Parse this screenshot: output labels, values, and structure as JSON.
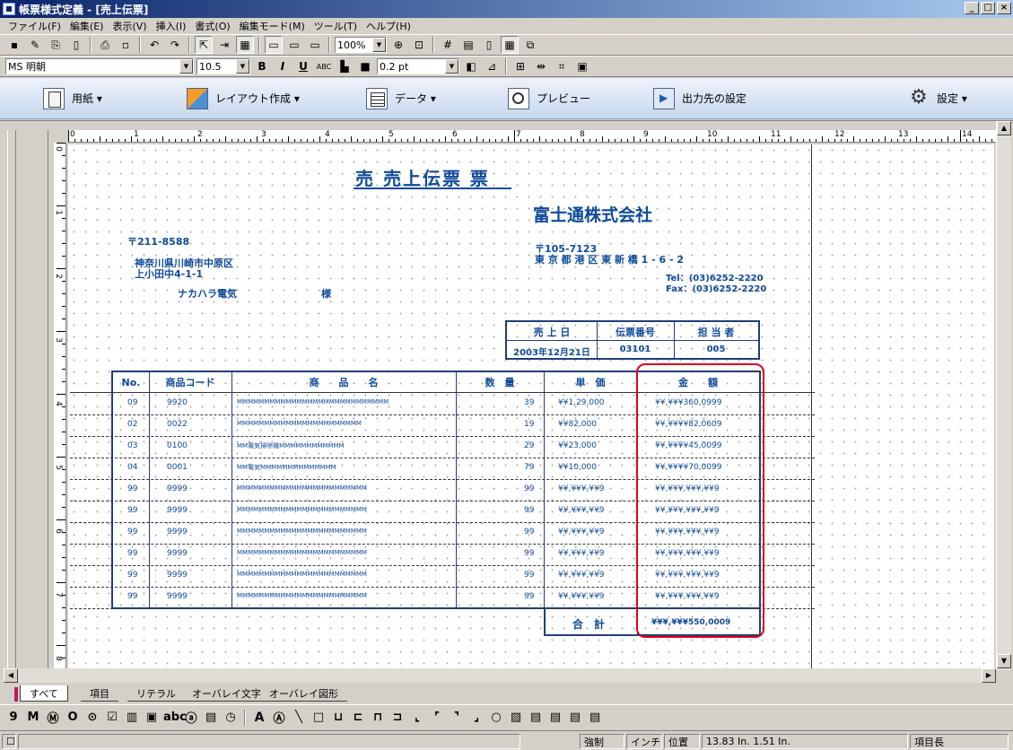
{
  "window": {
    "title": "帳票様式定義 - [売上伝票]",
    "min": "_",
    "max": "□",
    "close": "×"
  },
  "menu": [
    "ファイル(F)",
    "編集(E)",
    "表示(V)",
    "挿入(I)",
    "書式(O)",
    "編集モード(M)",
    "ツール(T)",
    "ヘルプ(H)"
  ],
  "toolbar": {
    "zoom": "100%",
    "font": "MS 明朝",
    "size": "10.5",
    "bold": "B",
    "italic": "I",
    "underline": "U",
    "abc": "ABC",
    "line_width": "0.2 pt"
  },
  "commands": [
    {
      "label": "用紙 ▾",
      "icon": "paper-icon"
    },
    {
      "label": "レイアウト作成 ▾",
      "icon": "layout-icon"
    },
    {
      "label": "データ ▾",
      "icon": "data-icon"
    },
    {
      "label": "プレビュー",
      "icon": "preview-icon"
    },
    {
      "label": "出力先の設定",
      "icon": "output-icon"
    },
    {
      "label": "設定 ▾",
      "icon": "settings-icon"
    }
  ],
  "ruler_top": [
    "0",
    "1",
    "2",
    "3",
    "4",
    "5",
    "6",
    "7",
    "8",
    "9",
    "10",
    "11",
    "12",
    "13",
    "14"
  ],
  "ruler_left": [
    "0",
    "1",
    "2",
    "3",
    "4",
    "5",
    "6",
    "7",
    "8"
  ],
  "form": {
    "title": "売 売上伝票 票",
    "company": "富士通株式会社",
    "postal": "〒211-8588",
    "address1": "神奈川県川崎市中原区",
    "address2": "上小田中4-1-1",
    "customer": "ナカハラ電気",
    "honorific": "様",
    "co_postal": "〒105-7123",
    "co_address": "東 京 都 港 区 東 新 橋 1 - 6 - 2",
    "tel": "Tel：(03)6252-2220",
    "fax": "Fax：(03)6252-2220",
    "header_labels": [
      "売 上 日",
      "伝票番号",
      "担 当 者"
    ],
    "header_values": [
      "2003年12月21日",
      "03101",
      "005"
    ],
    "columns": [
      "No.",
      "商品コード",
      "商　　品　　名",
      "数　量",
      "単　価",
      "金　　額"
    ],
    "rows": [
      {
        "no": "09",
        "code": "9920",
        "name": "MMMMMMMMMMMMMMMMMMMMMMMMMMMM",
        "qty": "39",
        "price": "¥¥1,29,000",
        "amount": "¥¥,¥¥¥360,0999"
      },
      {
        "no": "02",
        "code": "0022",
        "name": "MMMMMMMMMMMMMMMMMMMMMMM",
        "qty": "19",
        "price": "¥¥82,000",
        "amount": "¥¥,¥¥¥¥82,0609"
      },
      {
        "no": "03",
        "code": "0100",
        "name": "MM電気掃除機MMMMMMMMMMMM",
        "qty": "29",
        "price": "¥¥23,000",
        "amount": "¥¥,¥¥¥¥45,0099"
      },
      {
        "no": "04",
        "code": "0001",
        "name": "MM電気MMMMMMMMMMMMMM",
        "qty": "79",
        "price": "¥¥10,000",
        "amount": "¥¥,¥¥¥¥70,0099"
      },
      {
        "no": "99",
        "code": "9999",
        "name": "MMMMMMMMMMMMMMMMMMMMMMMM",
        "qty": "99",
        "price": "¥¥,¥¥¥,¥¥9",
        "amount": "¥¥,¥¥¥,¥¥¥,¥¥9"
      },
      {
        "no": "99",
        "code": "9999",
        "name": "MMMMMMMMMMMMMMMMMMMMMMMM",
        "qty": "99",
        "price": "¥¥,¥¥¥,¥¥9",
        "amount": "¥¥,¥¥¥,¥¥¥,¥¥9"
      },
      {
        "no": "99",
        "code": "9999",
        "name": "MMMMMMMMMMMMMMMMMMMMMMMM",
        "qty": "99",
        "price": "¥¥,¥¥¥,¥¥9",
        "amount": "¥¥,¥¥¥,¥¥¥,¥¥9"
      },
      {
        "no": "99",
        "code": "9999",
        "name": "MMMMMMMMMMMMMMMMMMMMMMMM",
        "qty": "99",
        "price": "¥¥,¥¥¥,¥¥9",
        "amount": "¥¥,¥¥¥,¥¥¥,¥¥9"
      },
      {
        "no": "99",
        "code": "9999",
        "name": "MMMMMMMMMMMMMMMMMMMMMMMM",
        "qty": "99",
        "price": "¥¥,¥¥¥,¥¥9",
        "amount": "¥¥,¥¥¥,¥¥¥,¥¥9"
      },
      {
        "no": "99",
        "code": "9999",
        "name": "MMMMMMMMMMMMMMMMMMMMMMMM",
        "qty": "99",
        "price": "¥¥,¥¥¥,¥¥9",
        "amount": "¥¥,¥¥¥,¥¥¥,¥¥9"
      }
    ],
    "total_label": "合　計",
    "total_value": "¥¥¥,¥¥¥550,0009"
  },
  "tabs": [
    "すべて",
    "項目",
    "リテラル",
    "オーバレイ文字",
    "オーバレイ図形"
  ],
  "toolbox": [
    "9",
    "M",
    "Ⓜ",
    "O",
    "⊙",
    "☑",
    "▥",
    "▣",
    "abc",
    "ⓐ",
    "▤",
    "◷"
  ],
  "toolbox_right": [
    "A",
    "Ⓐ",
    "╲",
    "□",
    "⊔",
    "⊏",
    "⊓",
    "⊐",
    "⌞",
    "⌜",
    "⌝",
    "⌟",
    "○",
    "▨",
    "▤",
    "▤",
    "▤",
    "▤"
  ],
  "status": {
    "mode": "強制",
    "unit": "インチ",
    "pos_label": "位置",
    "pos": "13.83 In.   1.51 In.",
    "item": "項目長"
  }
}
